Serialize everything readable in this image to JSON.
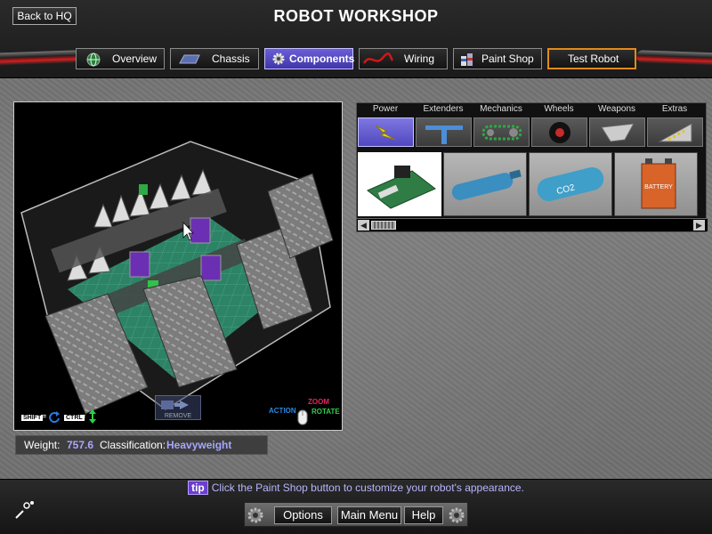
{
  "header": {
    "back_label": "Back to HQ",
    "title": "ROBOT WORKSHOP"
  },
  "tabs": [
    {
      "label": "Overview",
      "icon": "globe-icon"
    },
    {
      "label": "Chassis",
      "icon": "chassis-icon"
    },
    {
      "label": "Components",
      "icon": "gear-icon",
      "active": true
    },
    {
      "label": "Wiring",
      "icon": "wire-icon"
    },
    {
      "label": "Paint Shop",
      "icon": "paint-cans-icon"
    },
    {
      "label": "Test Robot",
      "icon": "hazard-stripe-icon"
    }
  ],
  "viewport": {
    "remove_label": "REMOVE",
    "hint_shift": "SHIFT",
    "hint_ctrl": "CTRL",
    "hint_eq1": "=",
    "hint_eq2": "=",
    "hint_action": "ACTION",
    "hint_zoom": "ZOOM",
    "hint_rotate": "ROTATE"
  },
  "stats": {
    "weight_label": "Weight:",
    "weight_value": "757.6",
    "class_label": "Classification:",
    "class_value": "Heavyweight"
  },
  "catalog": {
    "categories": [
      {
        "label": "Power",
        "icon": "lightning-icon",
        "active": true
      },
      {
        "label": "Extenders",
        "icon": "extender-icon"
      },
      {
        "label": "Mechanics",
        "icon": "chain-drive-icon"
      },
      {
        "label": "Wheels",
        "icon": "wheel-icon"
      },
      {
        "label": "Weapons",
        "icon": "blade-icon"
      },
      {
        "label": "Extras",
        "icon": "wedge-icon"
      }
    ],
    "items": [
      {
        "name": "circuit-board-item",
        "selected": true
      },
      {
        "name": "blue-tank-item"
      },
      {
        "name": "co2-tank-item",
        "label": "CO2"
      },
      {
        "name": "battery-item",
        "label": "BATTERY"
      }
    ],
    "scroll_left": "◀",
    "scroll_right": "▶"
  },
  "tip": {
    "badge": "tip",
    "text": "Click the Paint Shop button to customize your robot's appearance."
  },
  "menu": {
    "options_label": "Options",
    "main_menu_label": "Main Menu",
    "help_label": "Help"
  },
  "colors": {
    "accent": "#5147c0",
    "value_text": "#a7a6ff",
    "test_border": "#e28a1a"
  }
}
